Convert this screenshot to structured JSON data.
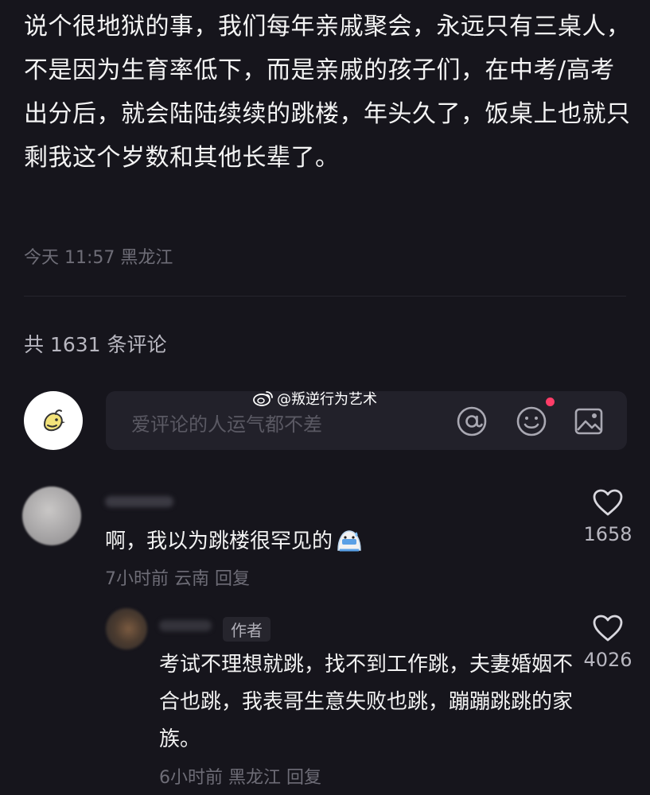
{
  "post": {
    "text": "说个很地狱的事，我们每年亲戚聚会，永远只有三桌人，不是因为生育率低下，而是亲戚的孩子们，在中考/高考出分后，就会陆陆续续的跳楼，年头久了，饭桌上也就只剩我这个岁数和其他长辈了。",
    "meta": "今天 11:57 黑龙江"
  },
  "comments_header": {
    "count_label": "共 1631 条评论"
  },
  "comment_input": {
    "placeholder": "爱评论的人运气都不差",
    "icons": [
      "at-icon",
      "emoji-icon",
      "image-icon"
    ]
  },
  "watermark": {
    "text": "@叛逆行为艺术"
  },
  "comments": [
    {
      "text": "啊，我以为跳楼很罕见的",
      "emoji": "sweating-emoji",
      "meta": "7小时前 云南 回复",
      "likes": "1658",
      "replies": [
        {
          "badge": "作者",
          "text": "考试不理想就跳，找不到工作跳，夫妻婚姻不合也跳，我表哥生意失败也跳，蹦蹦跳跳的家族。",
          "meta": "6小时前 黑龙江 回复",
          "likes": "4026"
        }
      ]
    }
  ],
  "colors": {
    "background": "#16151c",
    "text": "#f2f2f2",
    "muted": "#6e6d77",
    "accent_dot": "#ff3d68"
  }
}
